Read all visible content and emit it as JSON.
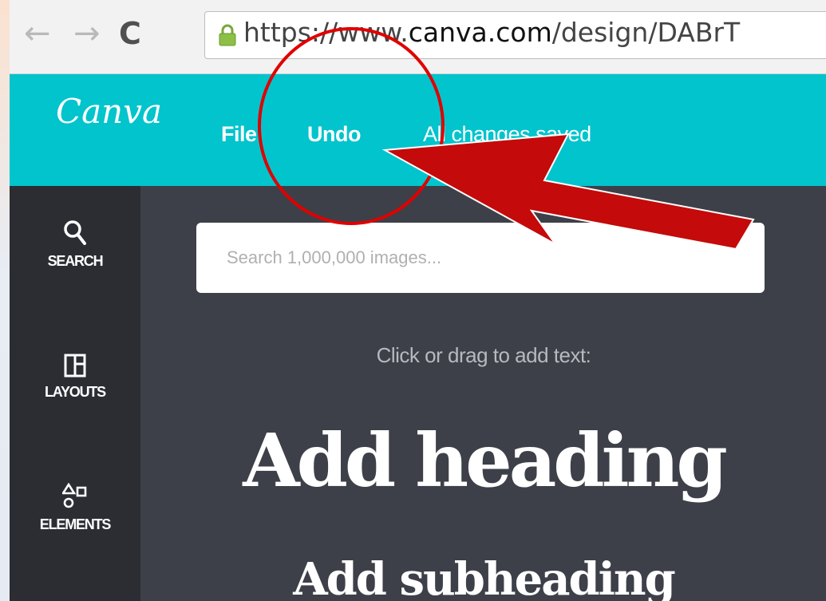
{
  "browser": {
    "back_icon": "back-arrow-icon",
    "forward_icon": "forward-arrow-icon",
    "reload_icon": "reload-icon",
    "url_scheme": "https://www.",
    "url_host": "canva.com",
    "url_path": "/design/DABrT"
  },
  "header": {
    "logo": "Canva",
    "menu": {
      "file": "File",
      "undo": "Undo"
    },
    "status": "All changes saved"
  },
  "sidebar": {
    "items": [
      {
        "label": "SEARCH",
        "icon": "search-icon"
      },
      {
        "label": "LAYOUTS",
        "icon": "layouts-icon"
      },
      {
        "label": "ELEMENTS",
        "icon": "elements-icon"
      }
    ]
  },
  "panel": {
    "search_placeholder": "Search 1,000,000 images...",
    "hint": "Click or drag to add text:",
    "heading": "Add heading",
    "subheading": "Add subheading"
  },
  "colors": {
    "header_bg": "#01c4cd",
    "sidebar_bg": "#2b2d33",
    "panel_bg": "#3d4048",
    "annotation_red": "#cc0000"
  }
}
